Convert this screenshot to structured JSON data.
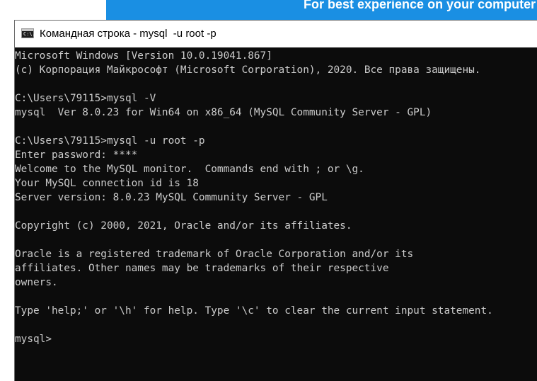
{
  "banner": {
    "text": "For best experience on your computer"
  },
  "window": {
    "icon": "cmd-icon",
    "icon_glyph": "C:\\.",
    "title": "Командная строка - mysql  -u root -p"
  },
  "console": {
    "lines": [
      "Microsoft Windows [Version 10.0.19041.867]",
      "(c) Корпорация Майкрософт (Microsoft Corporation), 2020. Все права защищены.",
      "",
      "C:\\Users\\79115>mysql -V",
      "mysql  Ver 8.0.23 for Win64 on x86_64 (MySQL Community Server - GPL)",
      "",
      "C:\\Users\\79115>mysql -u root -p",
      "Enter password: ****",
      "Welcome to the MySQL monitor.  Commands end with ; or \\g.",
      "Your MySQL connection id is 18",
      "Server version: 8.0.23 MySQL Community Server - GPL",
      "",
      "Copyright (c) 2000, 2021, Oracle and/or its affiliates.",
      "",
      "Oracle is a registered trademark of Oracle Corporation and/or its",
      "affiliates. Other names may be trademarks of their respective",
      "owners.",
      "",
      "Type 'help;' or '\\h' for help. Type '\\c' to clear the current input statement.",
      "",
      "mysql>"
    ]
  }
}
